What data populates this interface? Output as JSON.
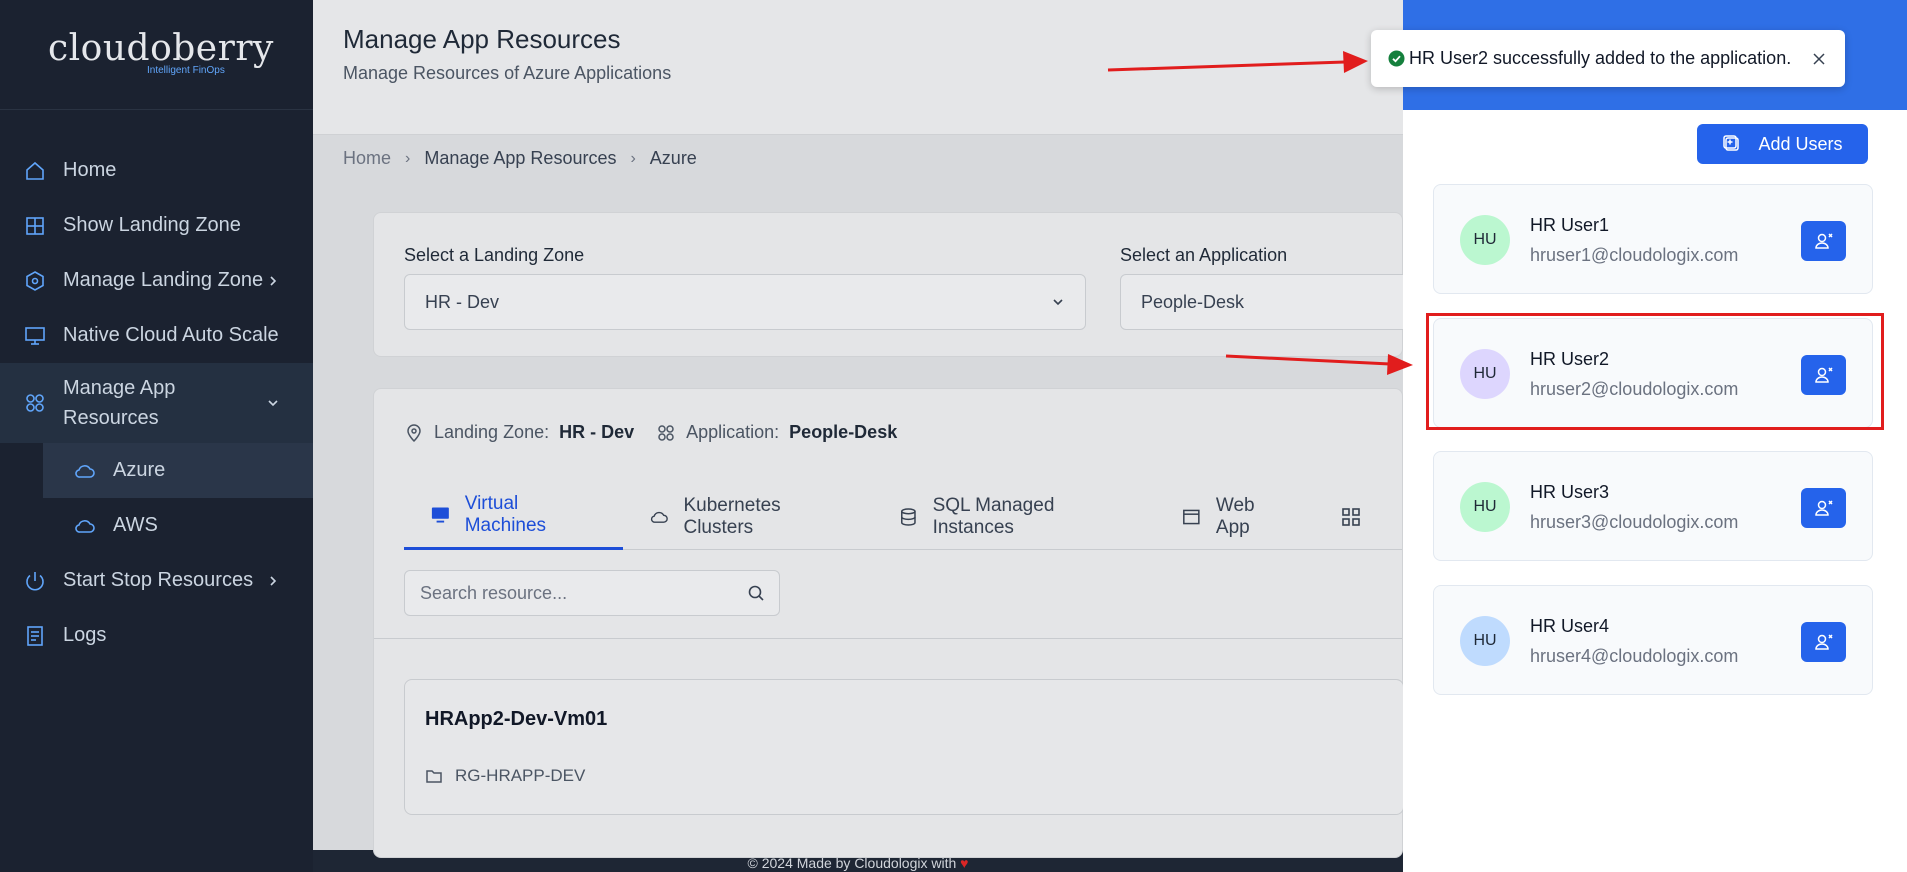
{
  "sidebar": {
    "logo": "cloudoberry",
    "logo_tagline": "Intelligent FinOps",
    "items": [
      {
        "label": "Home"
      },
      {
        "label": "Show Landing Zone"
      },
      {
        "label": "Manage Landing Zone"
      },
      {
        "label": "Native Cloud Auto Scale"
      },
      {
        "label": "Manage App Resources"
      },
      {
        "label": "Azure"
      },
      {
        "label": "AWS"
      },
      {
        "label": "Start Stop Resources"
      },
      {
        "label": "Logs"
      }
    ]
  },
  "header": {
    "title": "Manage App Resources",
    "subtitle": "Manage Resources of Azure Applications"
  },
  "breadcrumb": [
    "Home",
    "Manage App Resources",
    "Azure"
  ],
  "selectors": {
    "landing_zone_label": "Select a Landing Zone",
    "landing_zone_value": "HR - Dev",
    "application_label": "Select an Application",
    "application_value": "People-Desk"
  },
  "info": {
    "landing_zone_label": "Landing Zone:",
    "landing_zone_value": "HR - Dev",
    "application_label": "Application:",
    "application_value": "People-Desk"
  },
  "tabs": [
    {
      "label": "Virtual Machines"
    },
    {
      "label": "Kubernetes Clusters"
    },
    {
      "label": "SQL Managed Instances"
    },
    {
      "label": "Web App"
    }
  ],
  "search": {
    "placeholder": "Search resource..."
  },
  "vm": {
    "name": "HRApp2-Dev-Vm01",
    "resource_group": "RG-HRAPP-DEV"
  },
  "footer": "© 2024 Made by Cloudologix with",
  "toast": {
    "message": "HR User2 successfully added to the application."
  },
  "panel": {
    "add_users_label": "Add Users",
    "users": [
      {
        "initials": "HU",
        "name": "HR User1",
        "email": "hruser1@cloudologix.com",
        "avatar_color": "#bbf7d0"
      },
      {
        "initials": "HU",
        "name": "HR User2",
        "email": "hruser2@cloudologix.com",
        "avatar_color": "#ddd6fe"
      },
      {
        "initials": "HU",
        "name": "HR User3",
        "email": "hruser3@cloudologix.com",
        "avatar_color": "#bbf7d0"
      },
      {
        "initials": "HU",
        "name": "HR User4",
        "email": "hruser4@cloudologix.com",
        "avatar_color": "#bfdbfe"
      }
    ]
  },
  "colors": {
    "accent": "#2563eb",
    "highlight": "#e11d1d",
    "sidebar_bg": "#1b2230"
  }
}
